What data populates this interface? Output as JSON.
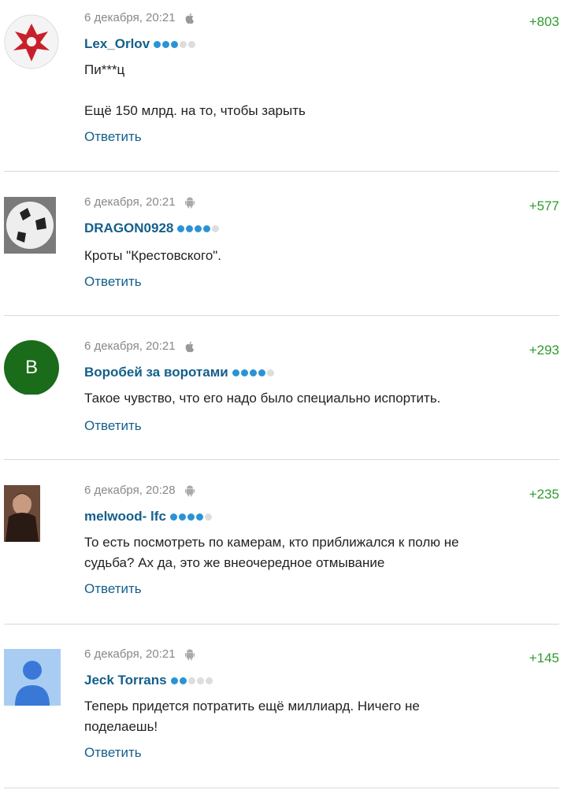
{
  "comments": [
    {
      "date": "6 декабря, 20:21",
      "device": "apple-icon",
      "author": "Lex_Orlov",
      "rank": 3,
      "rating": "+803",
      "lines": [
        "Пи***ц",
        "",
        "Ещё 150 млрд. на то, чтобы зарыть"
      ],
      "reply": "Ответить"
    },
    {
      "date": "6 декабря, 20:21",
      "device": "android-icon",
      "author": "DRAGON0928",
      "rank": 4,
      "rating": "+577",
      "lines": [
        "Кроты \"Крестовского\"."
      ],
      "reply": "Ответить"
    },
    {
      "date": "6 декабря, 20:21",
      "device": "apple-icon",
      "author": "Воробей за воротами",
      "rank": 4,
      "rating": "+293",
      "avatar_letter": "В",
      "lines": [
        "Такое чувство, что его надо было специально испортить."
      ],
      "reply": "Ответить"
    },
    {
      "date": "6 декабря, 20:28",
      "device": "android-icon",
      "author": "melwood- lfc",
      "rank": 4,
      "rating": "+235",
      "lines": [
        "То есть посмотреть по камерам, кто приближался к полю не",
        "судьба? Ах да, это же внеочередное отмывание"
      ],
      "reply": "Ответить"
    },
    {
      "date": "6 декабря, 20:21",
      "device": "android-icon",
      "author": "Jeck Torrans",
      "rank": 2,
      "rating": "+145",
      "lines": [
        "Теперь придется потратить ещё миллиард. Ничего не",
        "поделаешь!"
      ],
      "reply": "Ответить"
    }
  ],
  "colors": {
    "author": "#135f8a",
    "rating": "#2e9b2e",
    "dot_on": "#2a93d5",
    "dot_off": "#dddddd"
  }
}
